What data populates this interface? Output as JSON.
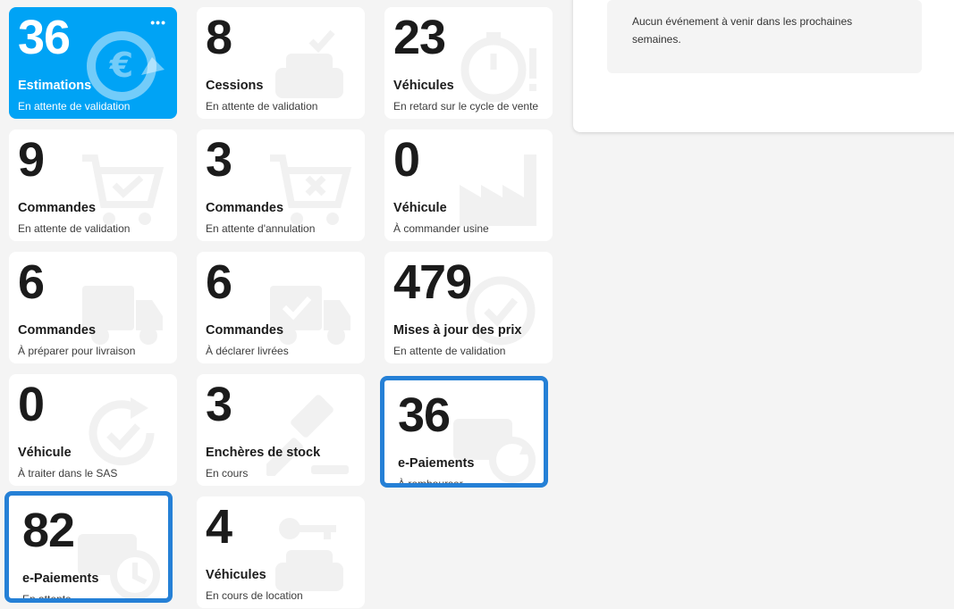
{
  "events_panel": {
    "message": "Aucun événement à venir dans les prochaines semaines."
  },
  "tiles": [
    {
      "count": "36",
      "title": "Estimations",
      "subtitle": "En attente de validation",
      "icon": "euro-refresh-icon",
      "active": true,
      "highlighted": false
    },
    {
      "count": "8",
      "title": "Cessions",
      "subtitle": "En attente de validation",
      "icon": "car-check-icon",
      "active": false,
      "highlighted": false
    },
    {
      "count": "23",
      "title": "Véhicules",
      "subtitle": "En retard sur le cycle de vente",
      "icon": "stopwatch-alert-icon",
      "active": false,
      "highlighted": false
    },
    {
      "count": "9",
      "title": "Commandes",
      "subtitle": "En attente de validation",
      "icon": "cart-check-icon",
      "active": false,
      "highlighted": false
    },
    {
      "count": "3",
      "title": "Commandes",
      "subtitle": "En attente d'annulation",
      "icon": "cart-cancel-icon",
      "active": false,
      "highlighted": false
    },
    {
      "count": "0",
      "title": "Véhicule",
      "subtitle": "À commander usine",
      "icon": "factory-icon",
      "active": false,
      "highlighted": false
    },
    {
      "count": "6",
      "title": "Commandes",
      "subtitle": "À préparer pour livraison",
      "icon": "truck-icon",
      "active": false,
      "highlighted": false
    },
    {
      "count": "6",
      "title": "Commandes",
      "subtitle": "À déclarer livrées",
      "icon": "truck-check-icon",
      "active": false,
      "highlighted": false
    },
    {
      "count": "479",
      "title": "Mises à jour des prix",
      "subtitle": "En attente de validation",
      "icon": "price-tag-icon",
      "active": false,
      "highlighted": false
    },
    {
      "count": "0",
      "title": "Véhicule",
      "subtitle": "À traiter dans le SAS",
      "icon": "refresh-check-icon",
      "active": false,
      "highlighted": false
    },
    {
      "count": "3",
      "title": "Enchères de stock",
      "subtitle": "En cours",
      "icon": "gavel-icon",
      "active": false,
      "highlighted": false
    },
    {
      "count": "36",
      "title": "e-Paiements",
      "subtitle": "À rembourser",
      "icon": "payment-refund-icon",
      "active": false,
      "highlighted": true
    },
    {
      "count": "82",
      "title": "e-Paiements",
      "subtitle": "En attente",
      "icon": "payment-clock-icon",
      "active": false,
      "highlighted": true
    },
    {
      "count": "4",
      "title": "Véhicules",
      "subtitle": "En cours de location",
      "icon": "car-key-icon",
      "active": false,
      "highlighted": false
    }
  ],
  "menu_label": "•••"
}
